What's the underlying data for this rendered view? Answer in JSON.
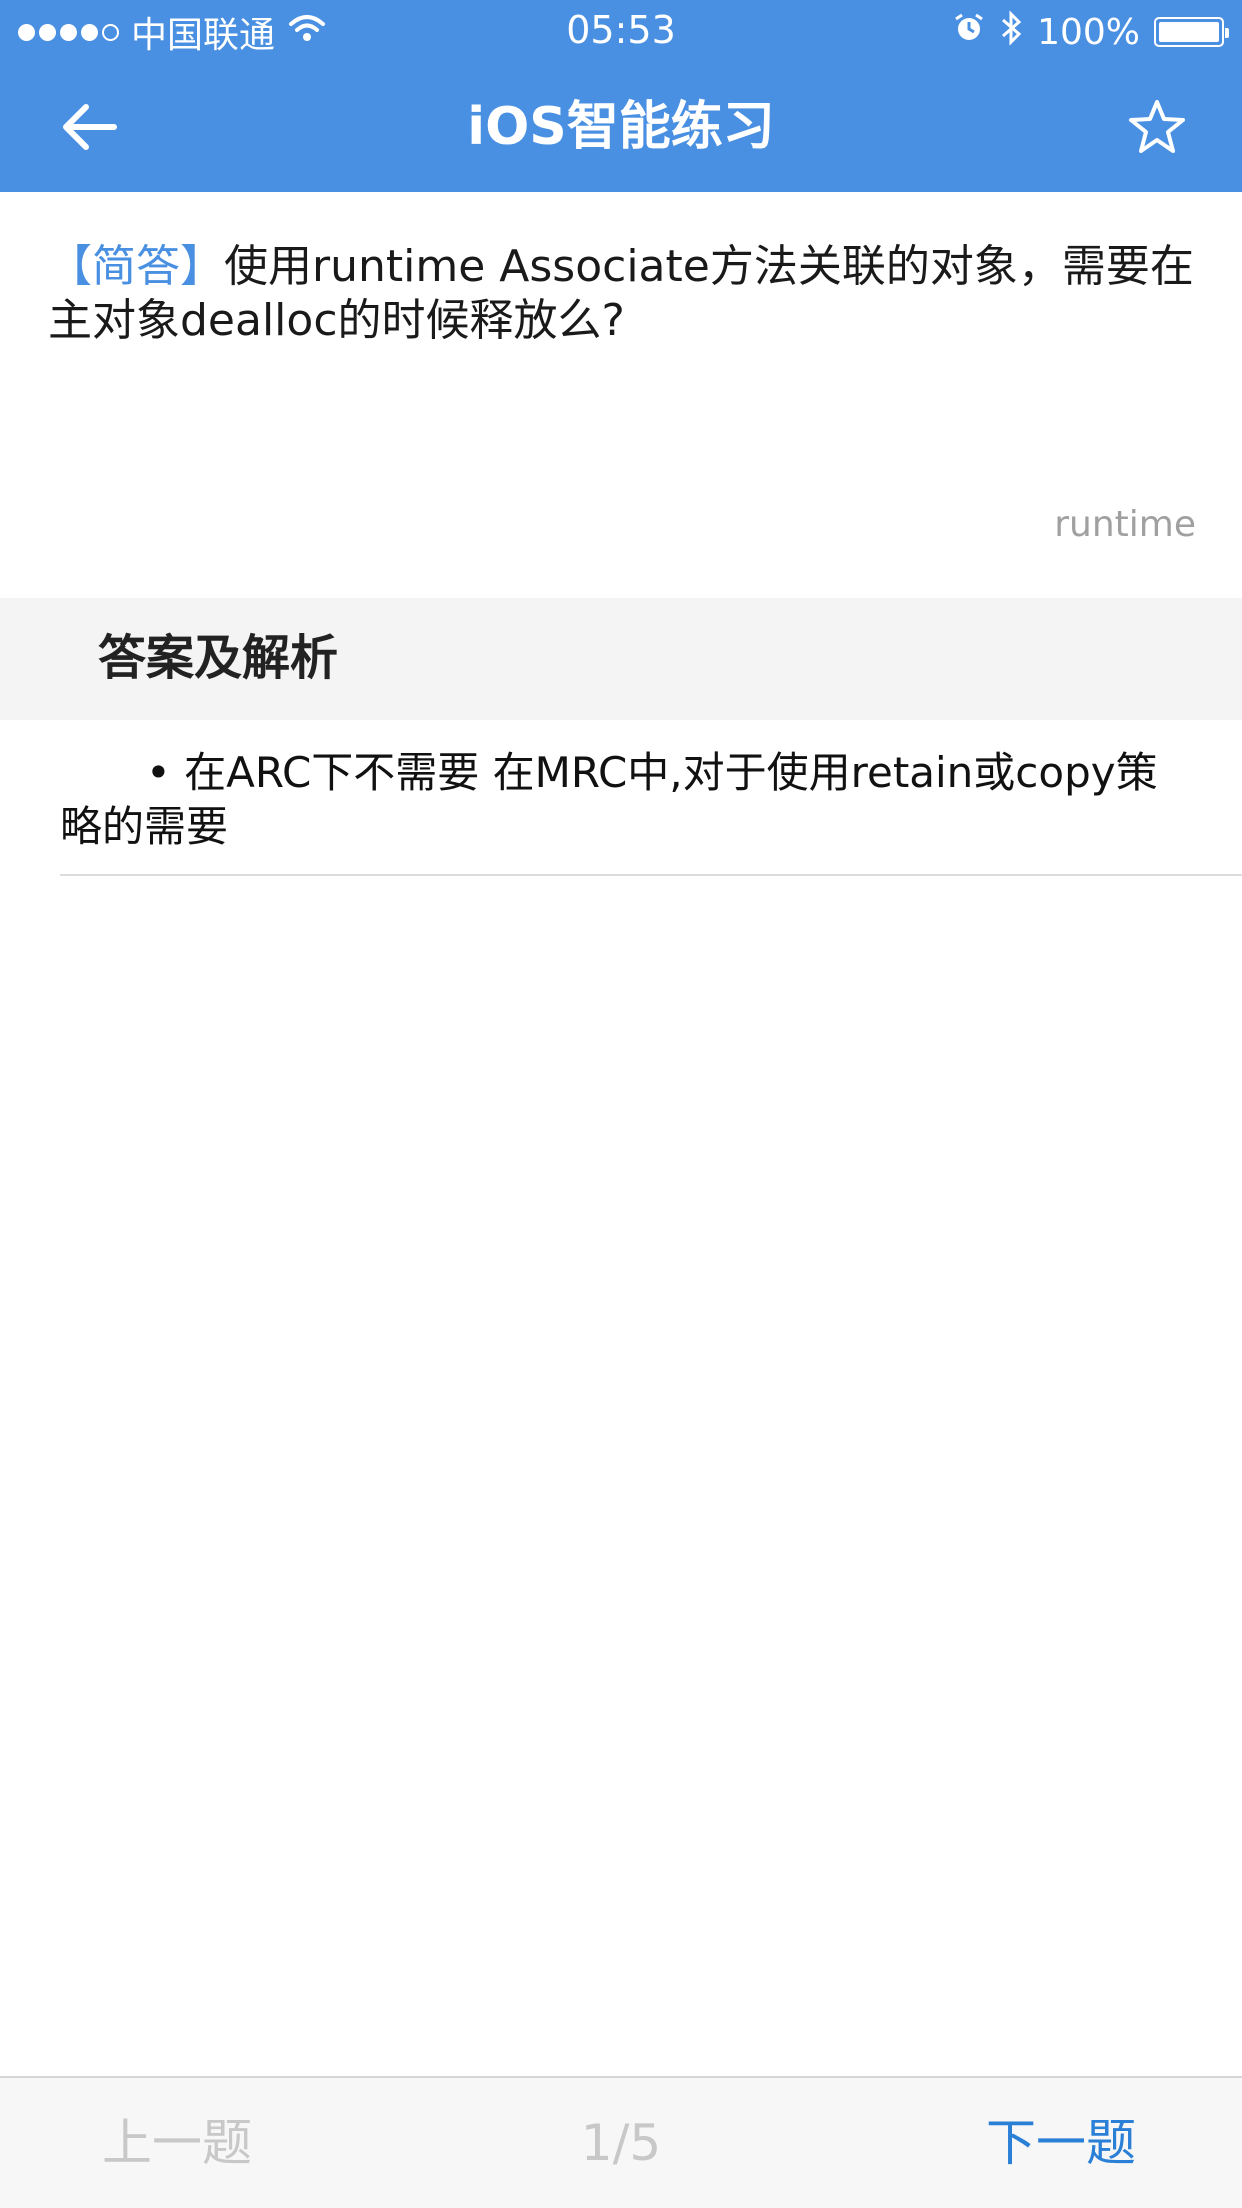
{
  "status_bar": {
    "carrier": "中国联通",
    "time": "05:53",
    "battery": "100%"
  },
  "nav": {
    "title": "iOS智能练习"
  },
  "question": {
    "type_label": "【简答】",
    "text": "使用runtime Associate方法关联的对象，需要在主对象dealloc的时候释放么?",
    "tag": "runtime"
  },
  "answer": {
    "header": "答案及解析",
    "text": "• 在ARC下不需要 在MRC中,对于使用retain或copy策略的需要"
  },
  "footer": {
    "prev_label": "上一题",
    "page": "1/5",
    "next_label": "下一题"
  },
  "colors": {
    "header_bg": "#4a90e2",
    "accent": "#2a7fd6",
    "disabled": "#c8c8c8"
  },
  "icons": {
    "back": "arrow-left-icon",
    "favorite": "star-outline-icon",
    "wifi": "wifi-icon",
    "alarm": "alarm-icon",
    "bluetooth": "bluetooth-icon"
  }
}
